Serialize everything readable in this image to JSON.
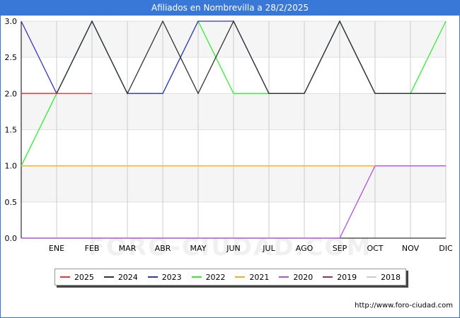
{
  "title": "Afiliados en Nombrevilla a 28/2/2025",
  "watermark": "FORO-CIUDAD.COM",
  "source_url": "http://www.foro-ciudad.com",
  "chart_data": {
    "type": "line",
    "title": "Afiliados en Nombrevilla a 28/2/2025",
    "xlabel": "",
    "ylabel": "",
    "categories": [
      "",
      "ENE",
      "FEB",
      "MAR",
      "ABR",
      "MAY",
      "JUN",
      "JUL",
      "AGO",
      "SEP",
      "OCT",
      "NOV",
      "DIC"
    ],
    "yticks": [
      "0.0",
      "0.5",
      "1.0",
      "1.5",
      "2.0",
      "2.5",
      "3.0"
    ],
    "ylim": [
      0,
      3
    ],
    "grid": true,
    "legend_position": "bottom",
    "series": [
      {
        "name": "2025",
        "color": "#ff3333",
        "values": [
          2,
          2,
          2,
          null,
          null,
          null,
          null,
          null,
          null,
          null,
          null,
          null,
          null
        ]
      },
      {
        "name": "2024",
        "color": "#333333",
        "values": [
          2,
          2,
          3,
          2,
          3,
          2,
          3,
          2,
          2,
          3,
          2,
          2,
          2
        ]
      },
      {
        "name": "2023",
        "color": "#3333cc",
        "values": [
          3,
          2,
          3,
          2,
          2,
          3,
          3,
          2,
          2,
          3,
          2,
          2,
          2
        ]
      },
      {
        "name": "2022",
        "color": "#33ee33",
        "values": [
          1,
          2,
          3,
          2,
          2,
          3,
          2,
          2,
          2,
          3,
          2,
          2,
          3
        ]
      },
      {
        "name": "2021",
        "color": "#ffaa22",
        "values": [
          1,
          1,
          1,
          1,
          1,
          1,
          1,
          1,
          1,
          1,
          1,
          null,
          null
        ]
      },
      {
        "name": "2020",
        "color": "#aa55dd",
        "values": [
          0,
          0,
          0,
          0,
          0,
          0,
          0,
          0,
          0,
          0,
          1,
          1,
          1
        ]
      },
      {
        "name": "2019",
        "color": "#993366",
        "values": [
          0,
          0,
          0,
          0,
          0,
          0,
          0,
          0,
          0,
          0,
          null,
          null,
          null
        ]
      },
      {
        "name": "2018",
        "color": "#cccccc",
        "values": [
          null,
          null,
          null,
          null,
          null,
          null,
          null,
          null,
          null,
          null,
          null,
          null,
          null
        ]
      }
    ]
  }
}
